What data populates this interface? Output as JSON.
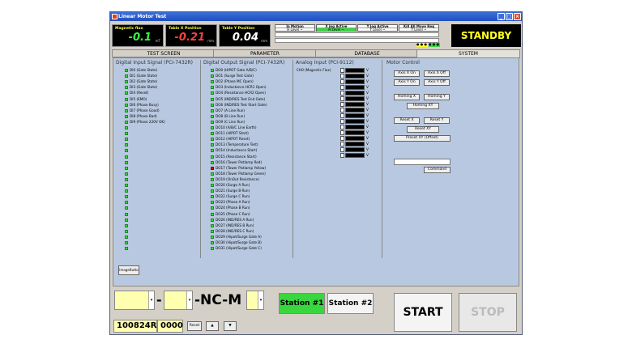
{
  "window": {
    "title": "Linear Motor Test"
  },
  "displays": [
    {
      "label": "Magnetic flux",
      "value": "-0.1",
      "unit": "mT",
      "color": "#30ff40"
    },
    {
      "label": "Table X Position",
      "value": "-0.21",
      "unit": "mm",
      "color": "#ff4040"
    },
    {
      "label": "Table Y Position",
      "value": "0.04",
      "unit": "mm",
      "color": "#ffffff"
    }
  ],
  "status_tables": [
    {
      "head": "In Motion",
      "val": "H Level ~"
    },
    {
      "head": "X Jog Active",
      "val": "H Level ~"
    },
    {
      "head": "Y Jog Active",
      "val": "Y Level ~"
    },
    {
      "head": "Kill All Move Req",
      "val": "Y Level ~"
    }
  ],
  "status_indicator": "STANDBY",
  "tabs": [
    "TEST SCREEN",
    "PARAMETER",
    "DATABASE",
    "SYSTEM"
  ],
  "active_tab": "SYSTEM",
  "digital_input": {
    "title": "Digital Input Signal (PCI-7432R)",
    "items": [
      "DI0 (Gate State)",
      "DI1 (Gate State)",
      "DI2 (Gate State)",
      "DI3 (Gate State)",
      "DI4 (Reset)",
      "DI5 (EMO)",
      "DI6 (Phase Busy)",
      "DI7 (Phase Good)",
      "DI8 (Phase Bad)",
      "DI9 (Phase 220V OK)"
    ],
    "blank_count": 22
  },
  "digital_output": {
    "title": "Digital Output Signal (PCI-7432R)",
    "items": [
      "DO0 (HIPOT Gate A/B/C)",
      "DO1 (Surge Test Gate)",
      "DO2 (Phase MC Open)",
      "DO3 (Inductance HCR1 Open)",
      "DO4 (Resistance HCR2 Open)",
      "DO5 (IND/RES Test End Gate)",
      "DO6 (IND/RES Test Start Gate)",
      "DO7 (A Line Run)",
      "DO8 (B Line Run)",
      "DO9 (C Line Run)",
      "DO10 (A/B/C Line Earth)",
      "DO11 (HIPOT Start)",
      "DO12 (HIPOT Reset)",
      "DO13 (Temperature Test)",
      "DO14 (Inductance Start)",
      "DO15 (Resistance Start)",
      "DO16 (Tower Pistlamp Red)",
      "DO17 (Tower Pistlamp Yellow)",
      "DO18 (Tower Pistlamp Green)",
      "DO19 (OnOut Resistance)",
      "DO20 (Surge A Run)",
      "DO21 (Surge B Run)",
      "DO22 (Surge C Run)",
      "DO23 (Phase A Run)",
      "DO24 (Phase B Run)",
      "DO25 (Phase C Run)",
      "DO26 (IND/RES A Run)",
      "DO27 (IND/RES B Run)",
      "DO28 (IND/RES C Run)",
      "DO29 (Hipot/Surge Gate A)",
      "DO30 (Hipot/Surge Gate B)",
      "DO31 (Hipot/Surge Gate C)"
    ],
    "active_index": 17
  },
  "analog_input": {
    "title": "Analog Input (PCI-9112)",
    "first_label": "CH0 (Magnetic Flux)",
    "unit": "V",
    "channels": 16
  },
  "motor_control": {
    "title": "Motor Control",
    "axis_x_on": "Axis X On",
    "axis_x_off": "Axis X Off",
    "axis_y_on": "Axis Y On",
    "axis_y_off": "Axis Y Off",
    "homing_x": "Homing X",
    "homing_y": "Homing Y",
    "homing_xy": "Homing XY",
    "reset_x": "Reset X",
    "reset_y": "Reset Y",
    "reset_xy": "Reset XY",
    "preset_xy": "Preset XY (Offset)",
    "command": "Command"
  },
  "image_button": "ImageButto",
  "bottom": {
    "dash1": "-",
    "nc_m": "-NC-M",
    "station1": "Station #1",
    "station2": "Station #2",
    "serial": "100824R",
    "count": "0000",
    "reset": "Reset",
    "up": "▲",
    "down": "▼",
    "start": "START",
    "stop": "STOP"
  },
  "colors": {
    "title_bar": "#1f4fc0",
    "led_green": "#40d840",
    "led_red": "#c01010",
    "station_active": "#3ad640",
    "standby_text": "#ffff20"
  }
}
